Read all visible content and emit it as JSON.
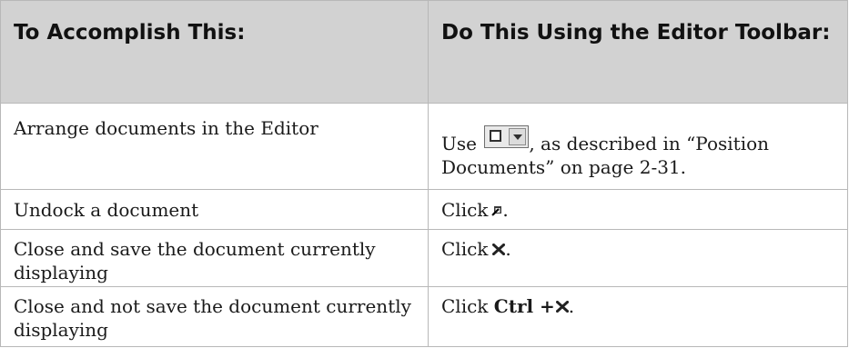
{
  "table": {
    "headers": {
      "left": "To Accomplish This:",
      "right": "Do This Using the Editor Toolbar:"
    },
    "rows": [
      {
        "task": "Arrange documents in the Editor",
        "action_prefix": "Use",
        "action_suffix": ", as described in “Position Documents” on page 2-31.",
        "icon": "window-position-dropdown-icon"
      },
      {
        "task": "Undock a document",
        "action_prefix": "Click",
        "action_suffix": ".",
        "icon": "undock-icon"
      },
      {
        "task": "Close and save the document currently displaying",
        "action_prefix": "Click",
        "action_suffix": ".",
        "icon": "close-x-icon"
      },
      {
        "task": "Close and not save the document currently displaying",
        "action_prefix": "Click",
        "action_key": "Ctrl +",
        "action_suffix": ".",
        "icon": "close-x-icon"
      }
    ]
  },
  "colors": {
    "header_background": "#d2d2d2",
    "border": "#b8b8b8"
  }
}
